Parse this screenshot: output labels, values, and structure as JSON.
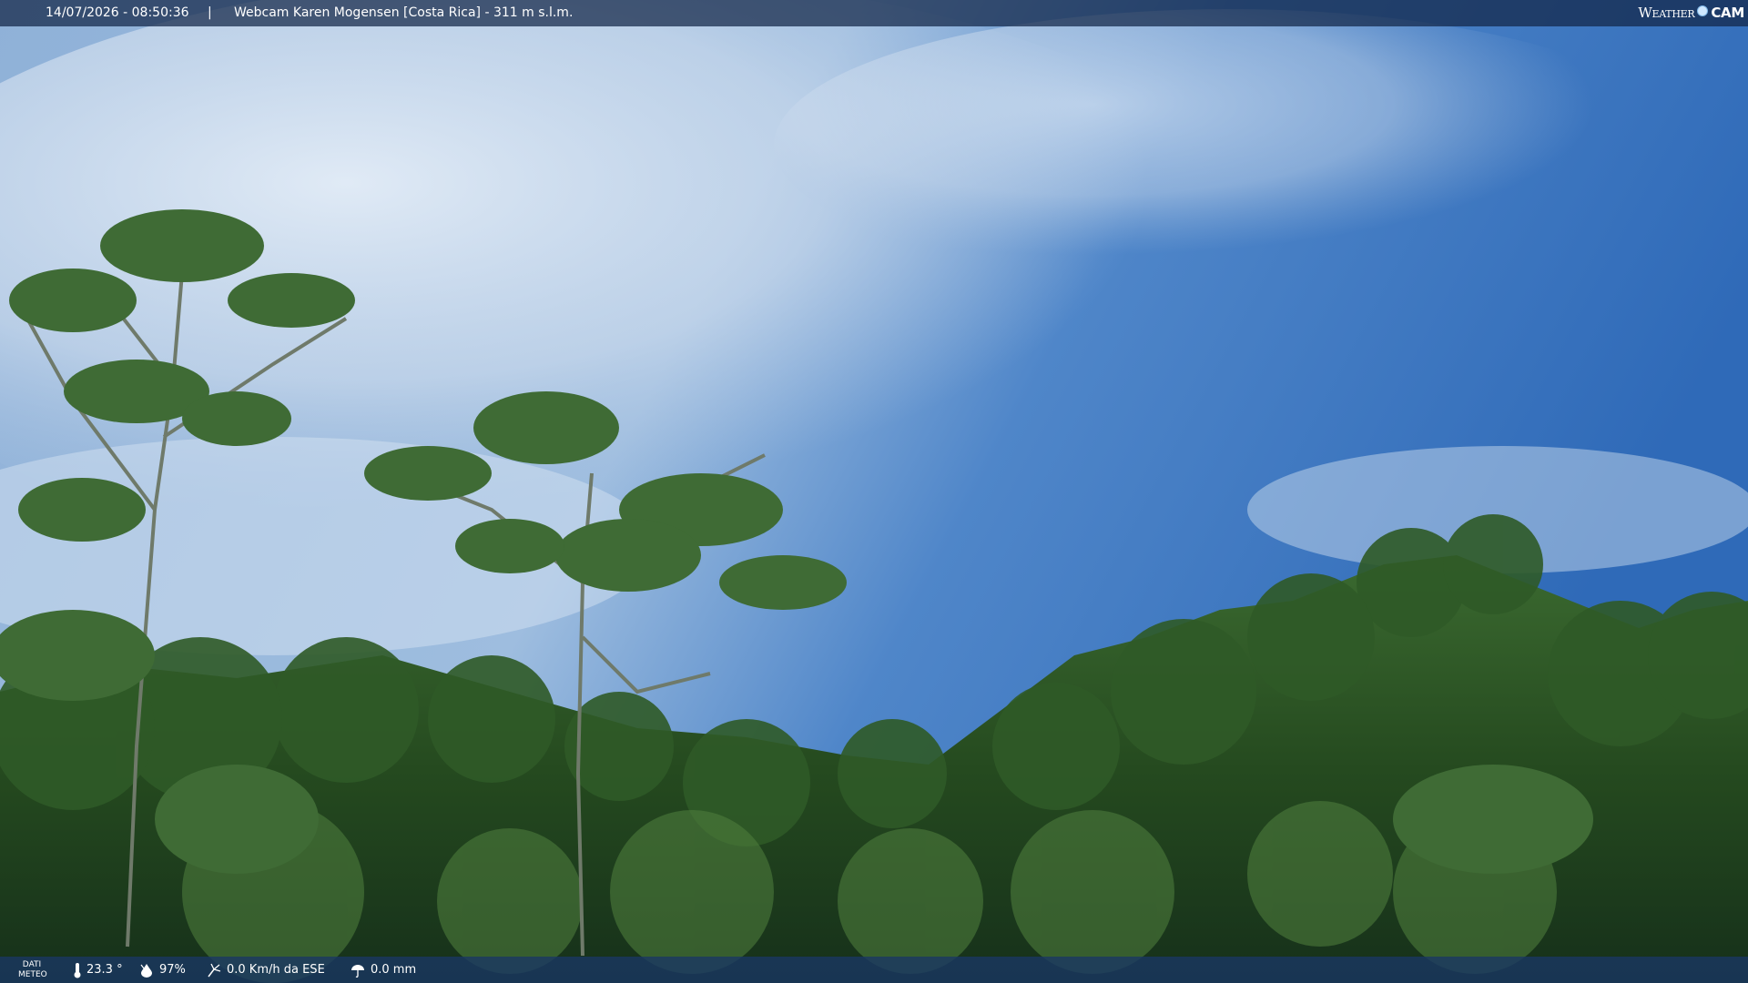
{
  "header": {
    "date_time": "14/07/2026 - 08:50:36",
    "separator": "|",
    "title": "Webcam Karen Mogensen [Costa Rica] - 311 m s.l.m.",
    "brand_left": "Weather",
    "brand_right": "CAM"
  },
  "weather": {
    "label": "DATI METEO",
    "temperature": "23.3 °",
    "humidity": "97%",
    "wind": "0.0 Km/h da ESE",
    "rain": "0.0 mm"
  },
  "icons": [
    "thermometer-icon",
    "humidity-drop-icon",
    "wind-icon",
    "rain-icon"
  ],
  "colors": {
    "sky": "#3a74c4",
    "foliage": "#2e5226",
    "bar": "#1a3760"
  }
}
